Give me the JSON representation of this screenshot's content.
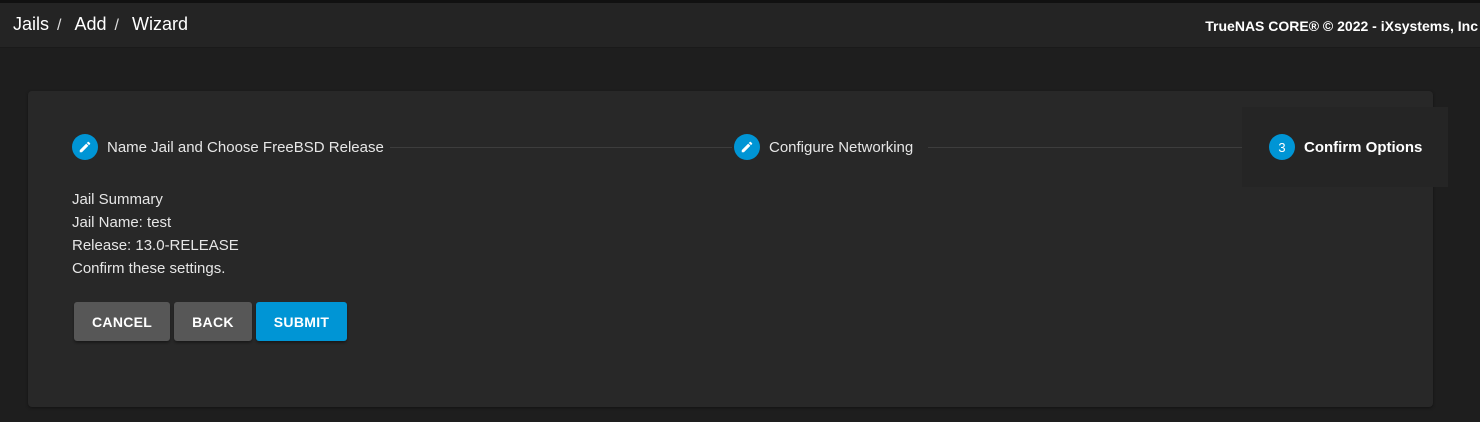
{
  "header": {
    "breadcrumb": [
      "Jails",
      "Add",
      "Wizard"
    ],
    "separator": "/",
    "copyright": "TrueNAS CORE® © 2022 - iXsystems, Inc"
  },
  "stepper": {
    "steps": [
      {
        "icon": "pencil-icon",
        "label": "Name Jail and Choose FreeBSD Release",
        "state": "done"
      },
      {
        "icon": "pencil-icon",
        "label": "Configure Networking",
        "state": "done"
      },
      {
        "number": "3",
        "label": "Confirm Options",
        "state": "active"
      }
    ]
  },
  "summary": {
    "title": "Jail Summary",
    "jail_name": "Jail Name: test",
    "release": "Release: 13.0-RELEASE",
    "confirm": "Confirm these settings."
  },
  "actions": {
    "cancel": "CANCEL",
    "back": "BACK",
    "submit": "SUBMIT"
  },
  "colors": {
    "accent": "#0095d5",
    "button_gray": "#575757",
    "background": "#1e1e1e",
    "card": "#282828"
  }
}
